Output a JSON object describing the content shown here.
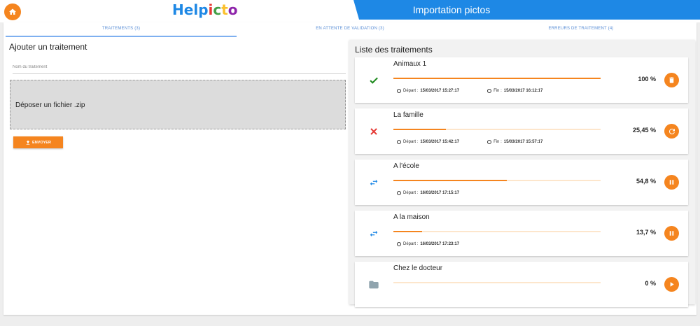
{
  "header": {
    "logo_text": "Helpicto",
    "title": "Importation pictos"
  },
  "tabs": [
    {
      "label": "TRAITEMENTS (3)"
    },
    {
      "label": "EN ATTENTE DE VALIDATION (3)"
    },
    {
      "label": "ERREURS DE TRAITEMENT (4)"
    }
  ],
  "left": {
    "title": "Ajouter un traitement",
    "name_placeholder": "Nom du traitement",
    "dropzone_label": "Déposer un fichier .zip",
    "send_label": "ENVOYER"
  },
  "right": {
    "title": "Liste des traitements",
    "start_label": "Départ :",
    "end_label": "Fin :",
    "items": [
      {
        "name": "Animaux 1",
        "status": "done",
        "status_icon": "check-icon",
        "status_color": "#1e8a1e",
        "progress": 1.0,
        "percent": "100 %",
        "start": "15/03/2017 15:27:17",
        "end": "15/03/2017 16:12:17",
        "action_icon": "delete-icon"
      },
      {
        "name": "La famille",
        "status": "error",
        "status_icon": "cross-icon",
        "status_color": "#e53935",
        "progress": 0.2545,
        "percent": "25,45 %",
        "start": "15/03/2017 15:42:17",
        "end": "15/03/2017 15:57:17",
        "action_icon": "retry-icon"
      },
      {
        "name": "A l'école",
        "status": "in-progress",
        "status_icon": "transfer-icon",
        "status_color": "#1e88e5",
        "progress": 0.548,
        "percent": "54,8 %",
        "start": "16/03/2017 17:15:17",
        "action_icon": "pause-icon"
      },
      {
        "name": "A la maison",
        "status": "in-progress",
        "status_icon": "transfer-icon",
        "status_color": "#1e88e5",
        "progress": 0.137,
        "percent": "13,7 %",
        "start": "16/03/2017 17:23:17",
        "action_icon": "pause-icon"
      },
      {
        "name": "Chez le docteur",
        "status": "queued",
        "status_icon": "folder-icon",
        "status_color": "#90a4ae",
        "progress": 0.0,
        "percent": "0 %",
        "action_icon": "play-icon"
      }
    ]
  },
  "colors": {
    "accent": "#f5851f",
    "brand_blue": "#1e88e5"
  }
}
